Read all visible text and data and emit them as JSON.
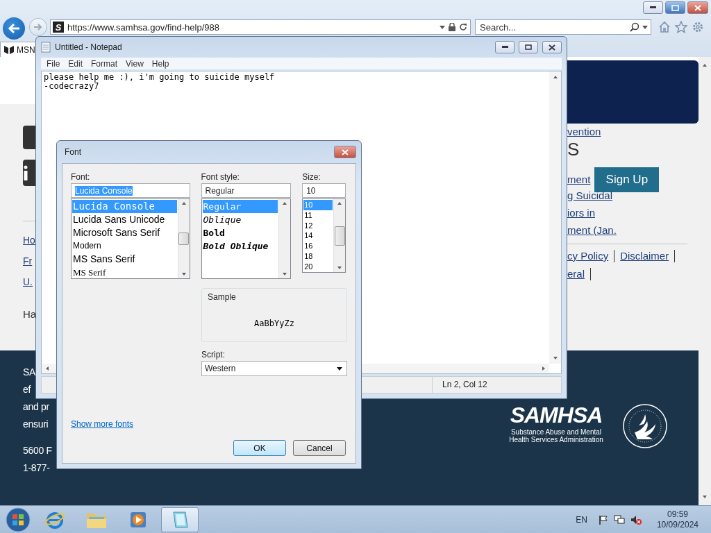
{
  "browser": {
    "favicon": "S",
    "url": "https://www.samhsa.gov/find-help/988",
    "search_placeholder": "Search...",
    "tab": {
      "label": "MSN"
    }
  },
  "page": {
    "left_links": [
      "Ho",
      "Fr",
      "U."
    ],
    "left_note": "Ha",
    "top_link": "vention",
    "heading": "S",
    "update_link": "ment",
    "sign_up": "Sign Up",
    "article_lines": [
      "g Suicidal",
      "iors in",
      "ment (Jan."
    ],
    "policy_links": [
      "cy Policy",
      "Disclaimer"
    ],
    "general_link": "eral",
    "footer_lines": [
      "SA",
      "ef",
      "and pr",
      "ensuri"
    ],
    "address_lines": [
      "5600 F",
      "1-877-"
    ],
    "logo": {
      "name": "SAMHSA",
      "subtitle": "Substance Abuse and Mental Health Services Administration"
    }
  },
  "notepad": {
    "title": "Untitled - Notepad",
    "menu": [
      "File",
      "Edit",
      "Format",
      "View",
      "Help"
    ],
    "lines": [
      "please help me :), i'm going to suicide myself",
      "-codecrazy7"
    ],
    "status": "Ln 2, Col 12"
  },
  "font_dialog": {
    "title": "Font",
    "font_label": "Font:",
    "font_field": {
      "value": "Lucida Console",
      "highlighted": true
    },
    "fonts": [
      {
        "label": "Lucida Console",
        "kind": "mono",
        "selected": true
      },
      {
        "label": "Lucida Sans Unicode",
        "kind": "sans",
        "selected": false
      },
      {
        "label": "Microsoft Sans Serif",
        "kind": "sans",
        "selected": false
      },
      {
        "label": "Modern",
        "kind": "narrow",
        "selected": false
      },
      {
        "label": "MS Sans Serif",
        "kind": "sans",
        "selected": false
      },
      {
        "label": "MS Serif",
        "kind": "serif",
        "selected": false
      }
    ],
    "style_label": "Font style:",
    "style_field": "Regular",
    "styles": [
      {
        "label": "Regular",
        "kind": "regular",
        "selected": true
      },
      {
        "label": "Oblique",
        "kind": "oblique",
        "selected": false
      },
      {
        "label": "Bold",
        "kind": "bold",
        "selected": false
      },
      {
        "label": "Bold Oblique",
        "kind": "bold-oblique",
        "selected": false
      }
    ],
    "size_label": "Size:",
    "size_field": "10",
    "sizes": [
      {
        "label": "10",
        "selected": true
      },
      {
        "label": "11",
        "selected": false
      },
      {
        "label": "12",
        "selected": false
      },
      {
        "label": "14",
        "selected": false
      },
      {
        "label": "16",
        "selected": false
      },
      {
        "label": "18",
        "selected": false
      },
      {
        "label": "20",
        "selected": false
      }
    ],
    "sample_label": "Sample",
    "sample": "AaBbYyZz",
    "script_label": "Script:",
    "script": "Western",
    "more_fonts": "Show more fonts",
    "ok": "OK",
    "cancel": "Cancel"
  },
  "taskbar": {
    "apps": [
      {
        "kind": "browser",
        "active": false
      },
      {
        "kind": "folder",
        "active": false
      },
      {
        "kind": "media",
        "active": false
      },
      {
        "kind": "notepad",
        "active": true
      }
    ],
    "language": "EN",
    "time": "09:59",
    "date": "10/09/2024"
  }
}
